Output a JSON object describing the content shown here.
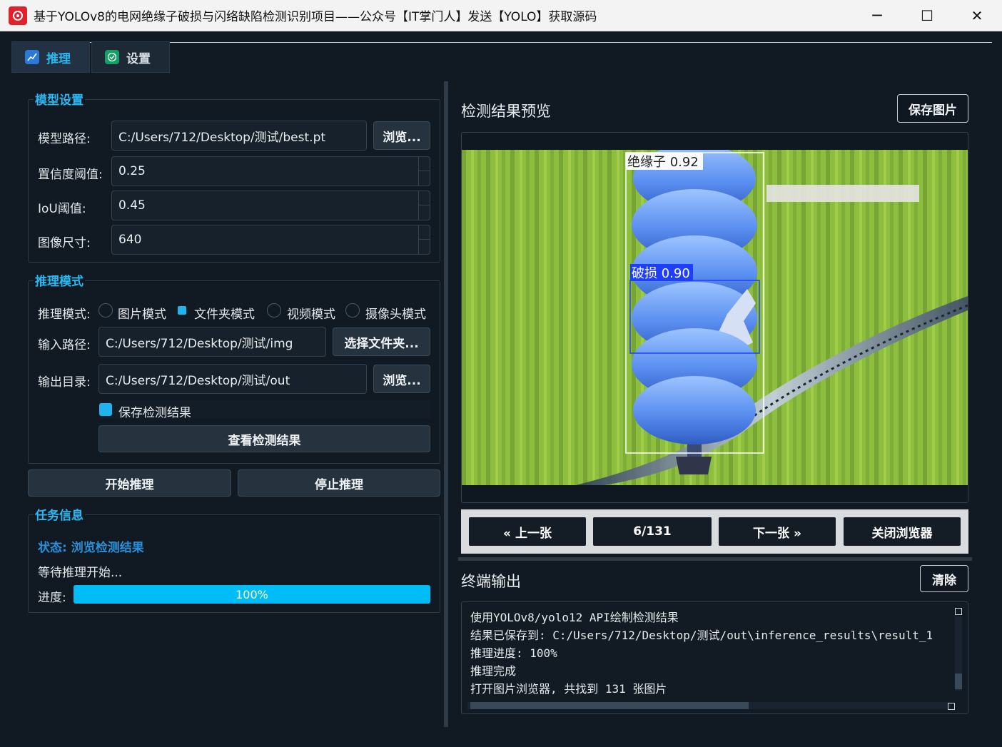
{
  "window": {
    "title": "基于YOLOv8的电网绝缘子破损与闪络缺陷检测识别项目——公众号【IT掌门人】发送【YOLO】获取源码",
    "minimize": "─",
    "maximize": "☐",
    "close": "✕"
  },
  "tabs": [
    {
      "label": "推理",
      "icon": "chart-icon"
    },
    {
      "label": "设置",
      "icon": "check-icon"
    }
  ],
  "model_settings": {
    "title": "模型设置",
    "model_path_label": "模型路径:",
    "model_path_value": "C:/Users/712/Desktop/测试/best.pt",
    "browse_label": "浏览...",
    "conf_label": "置信度阈值:",
    "conf_value": "0.25",
    "iou_label": "IoU阈值:",
    "iou_value": "0.45",
    "imgsz_label": "图像尺寸:",
    "imgsz_value": "640"
  },
  "inference_mode": {
    "title": "推理模式",
    "mode_label": "推理模式:",
    "modes": [
      {
        "label": "图片模式",
        "checked": false
      },
      {
        "label": "文件夹模式",
        "checked": true
      },
      {
        "label": "视频模式",
        "checked": false
      },
      {
        "label": "摄像头模式",
        "checked": false
      }
    ],
    "input_label": "输入路径:",
    "input_value": "C:/Users/712/Desktop/测试/img",
    "select_folder_label": "选择文件夹...",
    "output_label": "输出目录:",
    "output_value": "C:/Users/712/Desktop/测试/out",
    "output_browse_label": "浏览...",
    "save_results_label": "保存检测结果",
    "save_results_checked": true,
    "view_results_label": "查看检测结果"
  },
  "actions": {
    "start_label": "开始推理",
    "stop_label": "停止推理"
  },
  "task_info": {
    "title": "任务信息",
    "status": "状态: 浏览检测结果",
    "message": "等待推理开始...",
    "progress_label": "进度:",
    "progress_value": 100,
    "progress_text": "100%"
  },
  "preview": {
    "title": "检测结果预览",
    "save_label": "保存图片",
    "detections": [
      {
        "label": "绝缘子 0.92",
        "color": "#ffffff"
      },
      {
        "label": "破损 0.90",
        "color": "#1f3fff"
      }
    ]
  },
  "navigation": {
    "prev_label": "« 上一张",
    "counter": "6/131",
    "next_label": "下一张 »",
    "close_label": "关闭浏览器"
  },
  "terminal": {
    "title": "终端输出",
    "clear_label": "清除",
    "lines": [
      "使用YOLOv8/yolo12 API绘制检测结果",
      "结果已保存到: C:/Users/712/Desktop/测试/out\\inference_results\\result_1",
      "推理进度: 100%",
      "推理完成",
      "打开图片浏览器, 共找到 131 张图片"
    ]
  },
  "colors": {
    "accent": "#2bb8f2",
    "background": "#111a23",
    "progress": "#00bdf7"
  }
}
